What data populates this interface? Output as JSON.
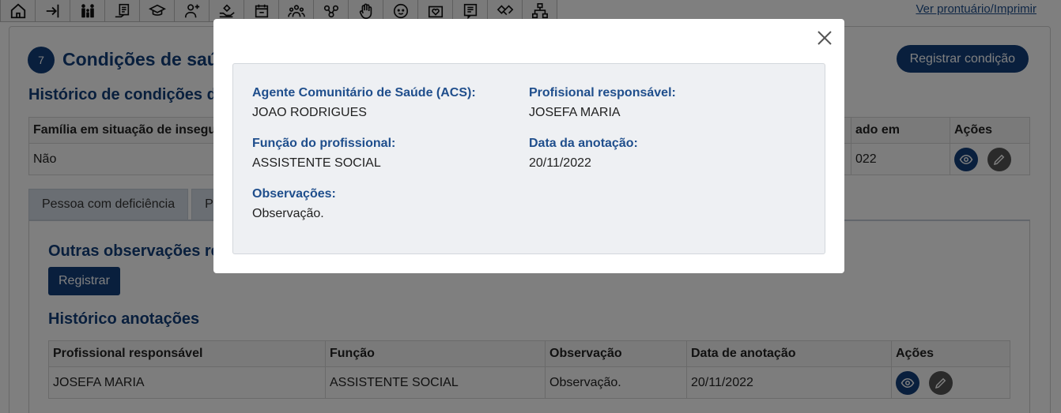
{
  "toolbar": {
    "icons": [
      "home-icon",
      "login-icon",
      "family-icon",
      "document-hand-icon",
      "graduation-cap-icon",
      "health-worker-icon",
      "hand-care-icon",
      "calendar-icon",
      "group-icon",
      "connections-icon",
      "hand-stop-icon",
      "child-face-icon",
      "heart-box-icon",
      "notes-icon",
      "handshake-icon",
      "hierarchy-icon"
    ],
    "print_link": "Ver prontuário/Imprimir"
  },
  "section": {
    "number": "7",
    "title": "Condições de saú",
    "register_button": "Registrar condição",
    "history_title": "Histórico de condições de"
  },
  "conditions_table": {
    "headers": [
      "Família em situação de insegur",
      "ado em",
      "Ações"
    ],
    "rows": [
      {
        "family": "Não",
        "date": "022"
      }
    ]
  },
  "tabs": [
    "Pessoa com deficiência",
    "Pre"
  ],
  "panel": {
    "title": "Outras observações ref",
    "register_button": "Registrar",
    "history_title": "Histórico anotações"
  },
  "notes_table": {
    "headers": [
      "Profissional responsável",
      "Função",
      "Observação",
      "Data de anotação",
      "Ações"
    ],
    "rows": [
      {
        "professional": "JOSEFA MARIA",
        "function": "ASSISTENTE SOCIAL",
        "observation": "Observação.",
        "date": "20/11/2022"
      }
    ]
  },
  "modal": {
    "acs_label": "Agente Comunitário de Saúde (ACS):",
    "acs_value": "JOAO RODRIGUES",
    "responsible_label": "Profisional responsável:",
    "responsible_value": "JOSEFA MARIA",
    "function_label": "Função do profissional:",
    "function_value": "ASSISTENTE SOCIAL",
    "date_label": "Data da anotação:",
    "date_value": "20/11/2022",
    "observations_label": "Observações:",
    "observations_value": "Observação."
  },
  "colors": {
    "primary": "#123e7a",
    "label": "#1f4e8c",
    "overlay": "rgba(0,0,0,0.5)"
  }
}
